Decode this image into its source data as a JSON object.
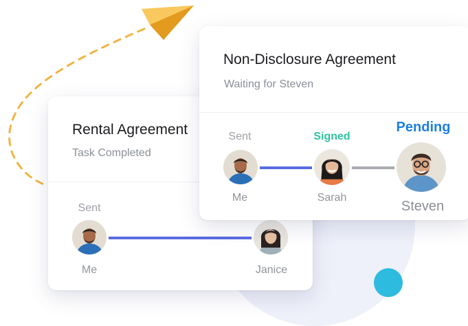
{
  "rental_card": {
    "title": "Rental Agreement",
    "subtitle": "Task Completed",
    "steps": [
      {
        "status": "Sent",
        "name": "Me"
      },
      {
        "status": "",
        "name": "Janice"
      }
    ]
  },
  "nda_card": {
    "title": "Non-Disclosure Agreement",
    "subtitle": "Waiting for Steven",
    "steps": [
      {
        "status": "Sent",
        "name": "Me"
      },
      {
        "status": "Signed",
        "name": "Sarah"
      },
      {
        "status": "Pending",
        "name": "Steven"
      }
    ]
  },
  "colors": {
    "completed_line": "#5b6be2",
    "waiting_line": "#a9abb1",
    "signed": "#2ec4a0",
    "pending": "#1e7fe0",
    "accent_dot": "#2dbbe0",
    "paper_plane": "#f3b23c"
  },
  "icons": [
    "paper-plane-icon"
  ]
}
